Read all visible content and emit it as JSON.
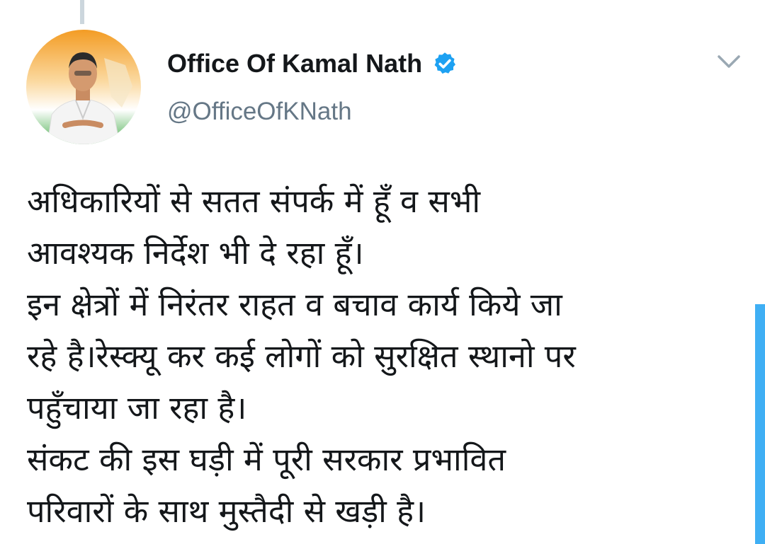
{
  "tweet": {
    "author": {
      "display_name": "Office Of Kamal Nath",
      "handle": "@OfficeOfKNath",
      "verified": true,
      "avatar_icon": "profile-photo"
    },
    "menu_icon": "chevron-down-icon",
    "text_lines": [
      "अधिकारियों से सतत संपर्क में हूँ व सभी",
      "आवश्यक निर्देश भी दे रहा हूँ।",
      "इन क्षेत्रों में निरंतर राहत व बचाव कार्य किये जा",
      "रहे है।रेस्क्यू कर कई लोगों को सुरक्षित स्थानो पर",
      "पहुँचाया जा रहा है।",
      "संकट की इस घड़ी में पूरी सरकार प्रभावित",
      "परिवारों के साथ मुस्तैदी से खड़ी है।"
    ]
  },
  "colors": {
    "text": "#14171a",
    "secondary_text": "#657786",
    "accent": "#1da1f2",
    "thread_line": "#ccd6dd",
    "avatar_saffron": "#f7a334",
    "avatar_green": "#3a9a3e"
  }
}
